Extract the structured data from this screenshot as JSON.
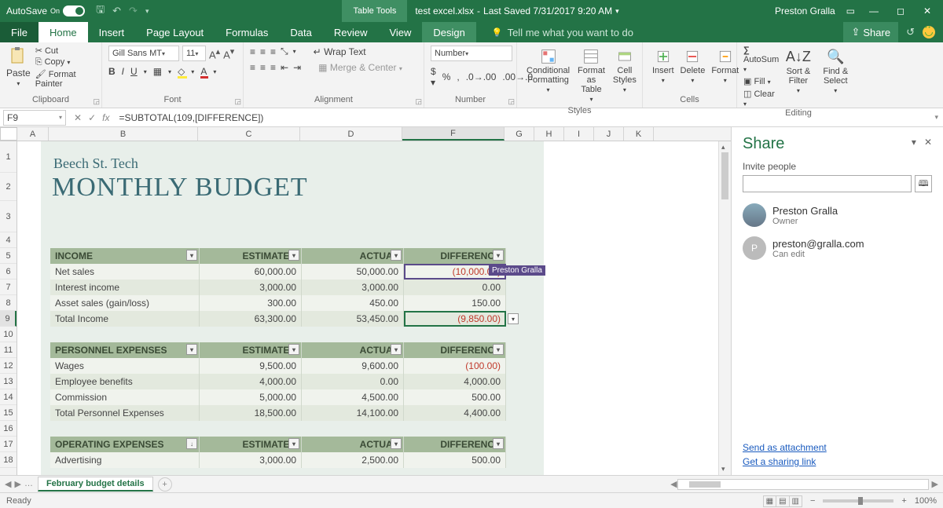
{
  "titlebar": {
    "autosave_label": "AutoSave",
    "autosave_state": "On",
    "table_tools": "Table Tools",
    "filename": "test excel.xlsx",
    "last_saved": "Last Saved 7/31/2017 9:20 AM",
    "user": "Preston Gralla"
  },
  "tabs": {
    "file": "File",
    "home": "Home",
    "insert": "Insert",
    "page_layout": "Page Layout",
    "formulas": "Formulas",
    "data": "Data",
    "review": "Review",
    "view": "View",
    "design": "Design",
    "tellme": "Tell me what you want to do",
    "share": "Share"
  },
  "ribbon": {
    "clipboard": {
      "paste": "Paste",
      "cut": "Cut",
      "copy": "Copy",
      "format_painter": "Format Painter",
      "label": "Clipboard"
    },
    "font": {
      "name": "Gill Sans MT",
      "size": "11",
      "label": "Font"
    },
    "alignment": {
      "wrap": "Wrap Text",
      "merge": "Merge & Center",
      "label": "Alignment"
    },
    "number": {
      "format": "Number",
      "label": "Number"
    },
    "styles": {
      "cond": "Conditional Formatting",
      "fmtas": "Format as Table",
      "cell": "Cell Styles",
      "label": "Styles"
    },
    "cells": {
      "insert": "Insert",
      "delete": "Delete",
      "format": "Format",
      "label": "Cells"
    },
    "editing": {
      "autosum": "AutoSum",
      "fill": "Fill",
      "clear": "Clear",
      "sort": "Sort & Filter",
      "find": "Find & Select",
      "label": "Editing"
    }
  },
  "formula": {
    "cell": "F9",
    "value": "=SUBTOTAL(109,[DIFFERENCE])"
  },
  "columns": [
    "A",
    "B",
    "C",
    "D",
    "F",
    "G",
    "H",
    "I",
    "J",
    "K"
  ],
  "rows": [
    "1",
    "2",
    "3",
    "4",
    "5",
    "6",
    "7",
    "8",
    "9",
    "10",
    "11",
    "12",
    "13",
    "14",
    "15",
    "16",
    "17",
    "18"
  ],
  "doc": {
    "company": "Beech St. Tech",
    "title": "MONTHLY BUDGET"
  },
  "income": {
    "header": [
      "INCOME",
      "ESTIMATED",
      "ACTUAL",
      "DIFFERENCE"
    ],
    "rows": [
      {
        "l": "Net sales",
        "e": "60,000.00",
        "a": "50,000.00",
        "d": "(10,000.00)",
        "neg": true
      },
      {
        "l": "Interest income",
        "e": "3,000.00",
        "a": "3,000.00",
        "d": "0.00"
      },
      {
        "l": "Asset sales (gain/loss)",
        "e": "300.00",
        "a": "450.00",
        "d": "150.00"
      },
      {
        "l": "Total Income",
        "e": "63,300.00",
        "a": "53,450.00",
        "d": "(9,850.00)",
        "neg": true
      }
    ]
  },
  "personnel": {
    "header": [
      "PERSONNEL EXPENSES",
      "ESTIMATED",
      "ACTUAL",
      "DIFFERENCE"
    ],
    "rows": [
      {
        "l": "Wages",
        "e": "9,500.00",
        "a": "9,600.00",
        "d": "(100.00)",
        "neg": true
      },
      {
        "l": "Employee benefits",
        "e": "4,000.00",
        "a": "0.00",
        "d": "4,000.00"
      },
      {
        "l": "Commission",
        "e": "5,000.00",
        "a": "4,500.00",
        "d": "500.00"
      },
      {
        "l": "Total Personnel Expenses",
        "e": "18,500.00",
        "a": "14,100.00",
        "d": "4,400.00"
      }
    ]
  },
  "operating": {
    "header": [
      "OPERATING EXPENSES",
      "ESTIMATED",
      "ACTUAL",
      "DIFFERENCE"
    ],
    "rows": [
      {
        "l": "Advertising",
        "e": "3,000.00",
        "a": "2,500.00",
        "d": "500.00"
      }
    ]
  },
  "presence_tag": "Preston Gralla",
  "sheet_tab": "February budget details",
  "status": {
    "ready": "Ready",
    "zoom": "100%"
  },
  "share_panel": {
    "title": "Share",
    "invite_label": "Invite people",
    "people": [
      {
        "name": "Preston Gralla",
        "role": "Owner",
        "initial": ""
      },
      {
        "name": "preston@gralla.com",
        "role": "Can edit",
        "initial": "P"
      }
    ],
    "links": {
      "attach": "Send as attachment",
      "link": "Get a sharing link"
    }
  }
}
